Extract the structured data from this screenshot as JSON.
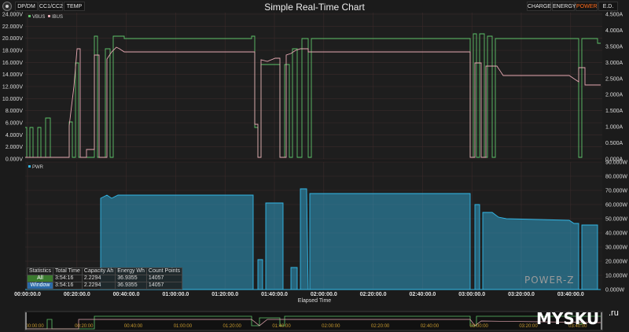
{
  "app": {
    "title": "Simple Real-Time Chart",
    "left_tabs": [
      "DP/DM",
      "CC1/CC2",
      "TEMP"
    ],
    "right_tabs": [
      "CHARGE",
      "ENERGY",
      "POWER",
      "E.D."
    ],
    "active_right_tab": "POWER"
  },
  "top_chart": {
    "legend": [
      "VBUS",
      "IBUS"
    ],
    "y_left_ticks": [
      "24.000V",
      "22.000V",
      "20.000V",
      "18.000V",
      "16.000V",
      "14.000V",
      "12.000V",
      "10.000V",
      "8.000V",
      "6.000V",
      "4.000V",
      "2.000V",
      "0.000V"
    ],
    "y_right_ticks": [
      "4.500A",
      "4.000A",
      "3.500A",
      "3.000A",
      "2.500A",
      "2.000A",
      "1.500A",
      "1.000A",
      "0.500A",
      "0.000A"
    ]
  },
  "bottom_chart": {
    "legend": [
      "PWR"
    ],
    "y_right_ticks": [
      "90.000W",
      "80.000W",
      "70.000W",
      "60.000W",
      "50.000W",
      "40.000W",
      "30.000W",
      "20.000W",
      "10.000W",
      "0.000W"
    ]
  },
  "x_axis": {
    "ticks": [
      "00:00:00.0",
      "00:20:00.0",
      "00:40:00.0",
      "01:00:00.0",
      "01:20:00.0",
      "01:40:00.0",
      "02:00:00.0",
      "02:20:00.0",
      "02:40:00.0",
      "03:00:00.0",
      "03:20:00.0",
      "03:40:00.0"
    ],
    "title": "Elapsed Time",
    "overview_ticks": [
      "00:00:00",
      "00:20:00",
      "00:40:00",
      "01:00:00",
      "01:20:00",
      "01:40:00",
      "02:00:00",
      "02:20:00",
      "02:40:00",
      "03:00:00",
      "03:20:00",
      "03:40:00"
    ]
  },
  "stats": {
    "headers": [
      "Statistics",
      "Total Time",
      "Capacity Ah",
      "Energy Wh",
      "Count Points"
    ],
    "rows": [
      [
        "All",
        "3:54:16",
        "2.2294",
        "36.9355",
        "14057"
      ],
      [
        "Window",
        "3:54:16",
        "2.2294",
        "36.9355",
        "14057"
      ]
    ]
  },
  "watermarks": {
    "brand": "POWER-Z",
    "site": "MYSKU",
    "site_suffix": ".ru"
  },
  "colors": {
    "vbus": "#5fc46a",
    "ibus": "#e6a9b3",
    "pwr": "#33b8e8",
    "active_tab": "#ff6a1a"
  }
}
